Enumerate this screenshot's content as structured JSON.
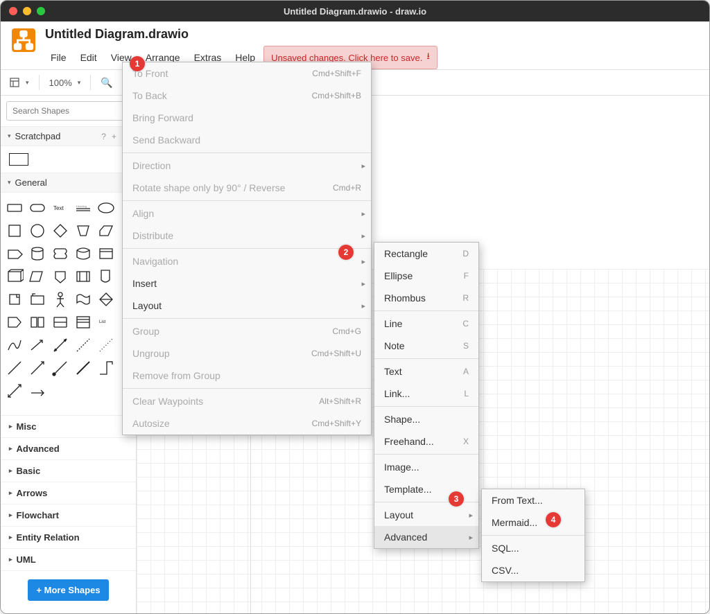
{
  "window": {
    "title": "Untitled Diagram.drawio - draw.io"
  },
  "header": {
    "doc_title": "Untitled Diagram.drawio"
  },
  "menubar": {
    "file": "File",
    "edit": "Edit",
    "view": "View",
    "arrange": "Arrange",
    "extras": "Extras",
    "help": "Help"
  },
  "save_chip": {
    "text": "Unsaved changes. Click here to save."
  },
  "toolbar": {
    "zoom": "100%"
  },
  "sidebar": {
    "search_placeholder": "Search Shapes",
    "scratchpad_label": "Scratchpad",
    "general_label": "General",
    "more_shapes": "+ More Shapes",
    "categories": [
      "Misc",
      "Advanced",
      "Basic",
      "Arrows",
      "Flowchart",
      "Entity Relation",
      "UML"
    ]
  },
  "arrange_menu": [
    {
      "label": "To Front",
      "sc": "Cmd+Shift+F",
      "disabled": true
    },
    {
      "label": "To Back",
      "sc": "Cmd+Shift+B",
      "disabled": true
    },
    {
      "label": "Bring Forward",
      "disabled": true
    },
    {
      "label": "Send Backward",
      "disabled": true
    },
    {
      "sep": true
    },
    {
      "label": "Direction",
      "disabled": true,
      "sub": true
    },
    {
      "label": "Rotate shape only by 90° / Reverse",
      "sc": "Cmd+R",
      "disabled": true
    },
    {
      "sep": true
    },
    {
      "label": "Align",
      "disabled": true,
      "sub": true
    },
    {
      "label": "Distribute",
      "disabled": true,
      "sub": true
    },
    {
      "sep": true
    },
    {
      "label": "Navigation",
      "disabled": true,
      "sub": true
    },
    {
      "label": "Insert",
      "sub": true,
      "highlight": false
    },
    {
      "label": "Layout",
      "sub": true
    },
    {
      "sep": true
    },
    {
      "label": "Group",
      "sc": "Cmd+G",
      "disabled": true
    },
    {
      "label": "Ungroup",
      "sc": "Cmd+Shift+U",
      "disabled": true
    },
    {
      "label": "Remove from Group",
      "disabled": true
    },
    {
      "sep": true
    },
    {
      "label": "Clear Waypoints",
      "sc": "Alt+Shift+R",
      "disabled": true
    },
    {
      "label": "Autosize",
      "sc": "Cmd+Shift+Y",
      "disabled": true
    }
  ],
  "insert_menu": [
    {
      "label": "Rectangle",
      "sc": "D"
    },
    {
      "label": "Ellipse",
      "sc": "F"
    },
    {
      "label": "Rhombus",
      "sc": "R"
    },
    {
      "sep": true
    },
    {
      "label": "Line",
      "sc": "C"
    },
    {
      "label": "Note",
      "sc": "S"
    },
    {
      "sep": true
    },
    {
      "label": "Text",
      "sc": "A"
    },
    {
      "label": "Link...",
      "sc": "L"
    },
    {
      "sep": true
    },
    {
      "label": "Shape..."
    },
    {
      "label": "Freehand...",
      "sc": "X"
    },
    {
      "sep": true
    },
    {
      "label": "Image..."
    },
    {
      "label": "Template..."
    },
    {
      "sep": true
    },
    {
      "label": "Layout",
      "sub": true
    },
    {
      "label": "Advanced",
      "sub": true,
      "highlight": true
    }
  ],
  "advanced_menu": [
    {
      "label": "From Text..."
    },
    {
      "label": "Mermaid..."
    },
    {
      "sep": true
    },
    {
      "label": "SQL..."
    },
    {
      "label": "CSV..."
    }
  ],
  "badges": {
    "1": "1",
    "2": "2",
    "3": "3",
    "4": "4"
  }
}
